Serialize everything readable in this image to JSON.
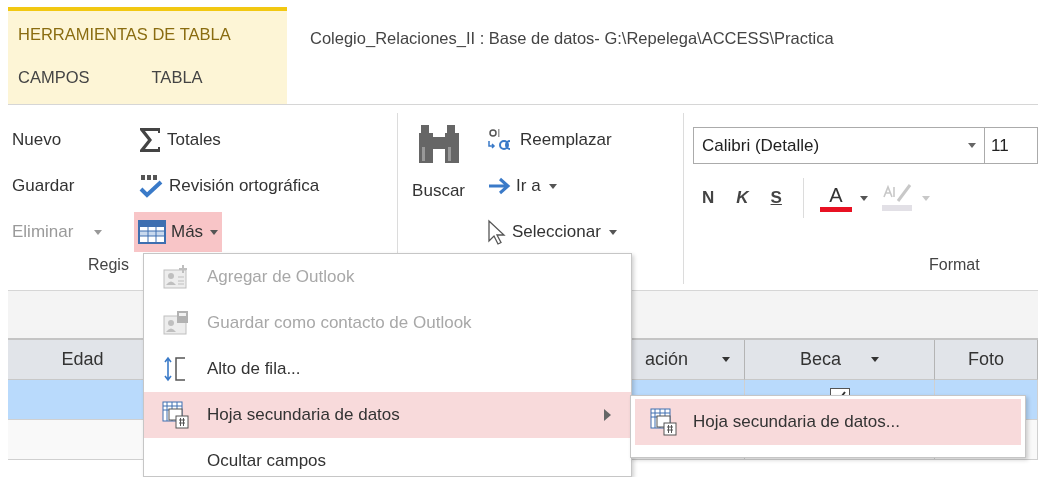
{
  "context_tabs": {
    "label": "HERRAMIENTAS DE TABLA",
    "tabs": [
      {
        "label": "CAMPOS",
        "selected": false
      },
      {
        "label": "TABLA",
        "selected": false
      }
    ]
  },
  "window": {
    "title": "Colegio_Relaciones_II : Base de datos- G:\\Repelega\\ACCESS\\Practica"
  },
  "records_group": {
    "label": "Regis",
    "commands": [
      {
        "kind": "plain",
        "label": "Nuevo",
        "disabled": false,
        "dropdown": false,
        "pressed": false
      },
      {
        "kind": "plain",
        "label": "Guardar",
        "disabled": false,
        "dropdown": false,
        "pressed": false
      },
      {
        "kind": "plain",
        "label": "Eliminar",
        "disabled": true,
        "dropdown": true,
        "pressed": false
      },
      {
        "kind": "sum",
        "label": "Totales",
        "disabled": false,
        "dropdown": false,
        "pressed": false
      },
      {
        "kind": "spelling",
        "label": "Revisión ortográfica",
        "disabled": false,
        "dropdown": false,
        "pressed": false
      },
      {
        "kind": "table",
        "label": "Más",
        "disabled": false,
        "dropdown": true,
        "pressed": true
      }
    ]
  },
  "find_group": {
    "large_button": {
      "label": "Buscar"
    },
    "commands": [
      {
        "kind": "replace",
        "label": "Reemplazar",
        "dropdown": false
      },
      {
        "kind": "goto",
        "label": "Ir a",
        "dropdown": true
      },
      {
        "kind": "select",
        "label": "Seleccionar",
        "dropdown": true
      }
    ]
  },
  "format_group": {
    "label": "Format",
    "font_field": {
      "value": "Calibri (Detalle)"
    },
    "size_field": {
      "value": "11"
    },
    "style_buttons": [
      {
        "kind": "bold",
        "label": "N"
      },
      {
        "kind": "italic",
        "label": "K"
      },
      {
        "kind": "underline",
        "label": "S"
      }
    ],
    "font_color_button": {
      "label": "A"
    },
    "highlight_button": {
      "disabled": true
    }
  },
  "datasheet": {
    "columns": [
      {
        "label": "Edad",
        "filter": false
      },
      {
        "label": "ación",
        "filter": true
      },
      {
        "label": "Beca",
        "filter": true
      },
      {
        "label": "Foto",
        "filter": false
      }
    ],
    "rows": [
      {
        "selected": true,
        "beca_checked": true
      },
      {
        "selected": false
      }
    ]
  },
  "menu": {
    "items": [
      {
        "kind": "add-contact",
        "label": "Agregar de Outlook",
        "disabled": true,
        "submenu": false,
        "selected": false
      },
      {
        "kind": "save-contact",
        "label": "Guardar como contacto de Outlook",
        "disabled": true,
        "submenu": false,
        "selected": false
      },
      {
        "kind": "row-height",
        "label": "Alto de fila...",
        "disabled": false,
        "submenu": false,
        "selected": false
      },
      {
        "kind": "subdatasheet",
        "label": "Hoja secundaria de datos",
        "disabled": false,
        "submenu": true,
        "selected": true
      },
      {
        "kind": "plain",
        "label": "Ocultar campos",
        "disabled": false,
        "submenu": false,
        "selected": false
      }
    ]
  },
  "submenu": {
    "items": [
      {
        "kind": "subdatasheet",
        "label": "Hoja secundaria de datos...",
        "selected": true
      }
    ]
  }
}
